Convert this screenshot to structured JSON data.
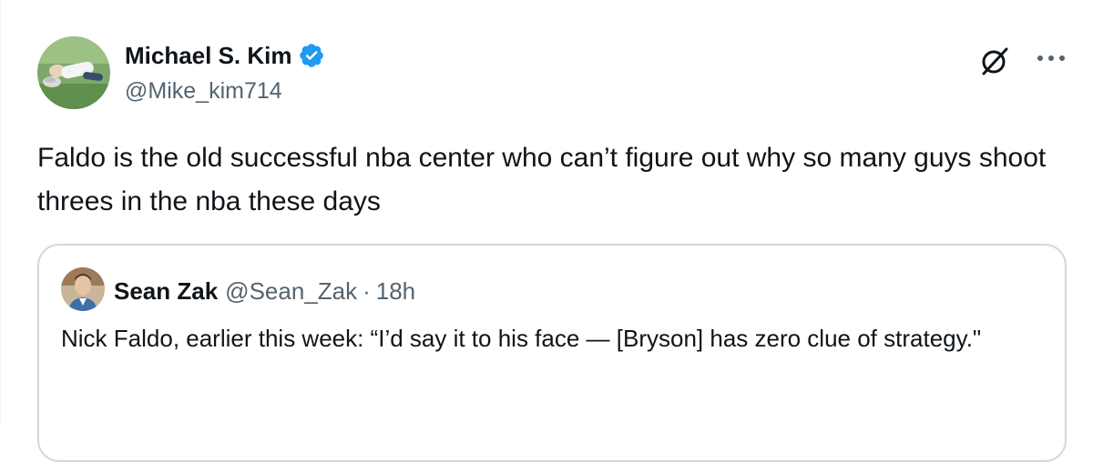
{
  "tweet": {
    "author": {
      "display_name": "Michael S. Kim",
      "handle": "@Mike_kim714",
      "verified": true,
      "avatar_icon": "golfer-avatar"
    },
    "text": "Faldo is the old successful nba center who can’t figure out why so many guys shoot threes in the nba these days",
    "actions": {
      "grok_icon": "grok-icon",
      "more_icon": "more-icon"
    }
  },
  "quoted_tweet": {
    "author": {
      "display_name": "Sean Zak",
      "handle": "@Sean_Zak",
      "avatar_icon": "person-avatar"
    },
    "separator": "·",
    "time": "18h",
    "text": "Nick Faldo, earlier this week: “I’d say it to his face — [Bryson] has zero clue of strategy.\""
  },
  "colors": {
    "text_primary": "#0f1419",
    "text_secondary": "#536471",
    "verified_blue": "#1d9bf0",
    "border": "#cfd9de"
  }
}
